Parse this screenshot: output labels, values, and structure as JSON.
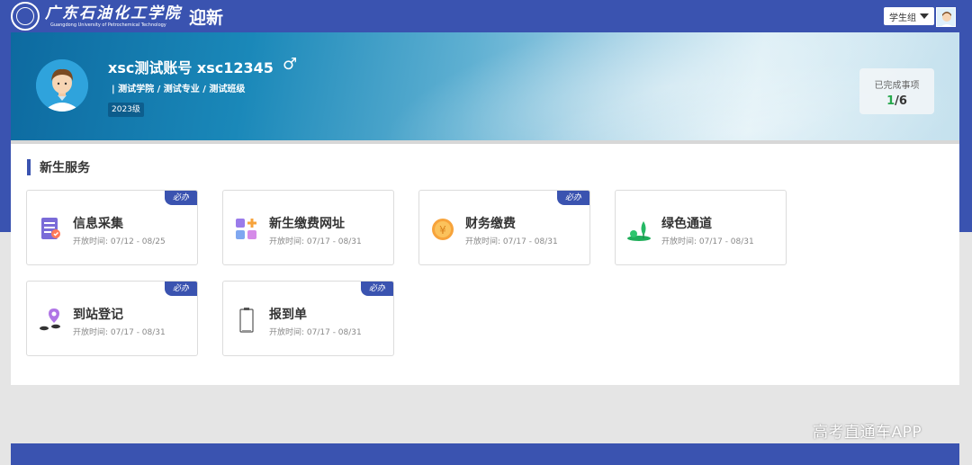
{
  "header": {
    "school_name_cn": "广东石油化工学院",
    "school_name_en": "Guangdong University of Petrochemical Technology",
    "app_title": "迎新",
    "role_select_value": "学生组",
    "colors": {
      "primary": "#3a53b0",
      "success": "#26a84c"
    }
  },
  "profile": {
    "name": "xsc测试账号  xsc12345",
    "gender_icon": "♂",
    "path": "| 测试学院 / 测试专业 / 测试班级",
    "grade": "2023级",
    "completed_label": "已完成事项",
    "completed_done": "1",
    "completed_total": "/6"
  },
  "services": {
    "section_title": "新生服务",
    "items": [
      {
        "title": "信息采集",
        "time": "开放时间: 07/12 - 08/25",
        "badge": "必办",
        "icon": "document-form-icon"
      },
      {
        "title": "新生缴费网址",
        "time": "开放时间: 07/17 - 08/31",
        "badge": "",
        "icon": "app-grid-icon"
      },
      {
        "title": "财务缴费",
        "time": "开放时间: 07/17 - 08/31",
        "badge": "必办",
        "icon": "coin-icon"
      },
      {
        "title": "绿色通道",
        "time": "开放时间: 07/17 - 08/31",
        "badge": "",
        "icon": "tree-icon"
      },
      {
        "title": "到站登记",
        "time": "开放时间: 07/17 - 08/31",
        "badge": "必办",
        "icon": "location-pin-icon"
      },
      {
        "title": "报到单",
        "time": "开放时间: 07/17 - 08/31",
        "badge": "必办",
        "icon": "clipboard-icon"
      }
    ]
  },
  "watermark": "高考直通车APP"
}
